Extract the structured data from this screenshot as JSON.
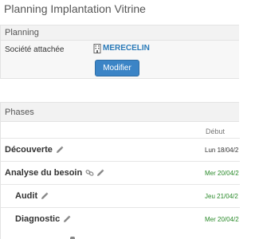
{
  "page": {
    "title": "Planning Implantation Vitrine"
  },
  "planning": {
    "heading": "Planning",
    "company_label": "Société attachée",
    "company_name": "MERECELIN",
    "modify_label": "Modifier"
  },
  "phases": {
    "heading": "Phases",
    "columns": {
      "start": "Début"
    },
    "rows": [
      {
        "name": "Découverte",
        "date": "Lun 18/04/2",
        "date_color": "default",
        "icons": [
          "pencil-icon"
        ]
      },
      {
        "name": "Analyse du besoin",
        "date": "Mer 20/04/2",
        "date_color": "green",
        "icons": [
          "link-icon",
          "pencil-icon"
        ]
      },
      {
        "name": "Audit",
        "date": "Jeu 21/04/2",
        "date_color": "green",
        "icons": [
          "pencil-icon"
        ]
      },
      {
        "name": "Diagnostic",
        "date": "Mer 20/04/2",
        "date_color": "green",
        "icons": [
          "pencil-icon"
        ]
      }
    ]
  },
  "colors": {
    "accent": "#3b84c6",
    "link": "#2a7ab8",
    "date_green": "#2a8a2a"
  }
}
